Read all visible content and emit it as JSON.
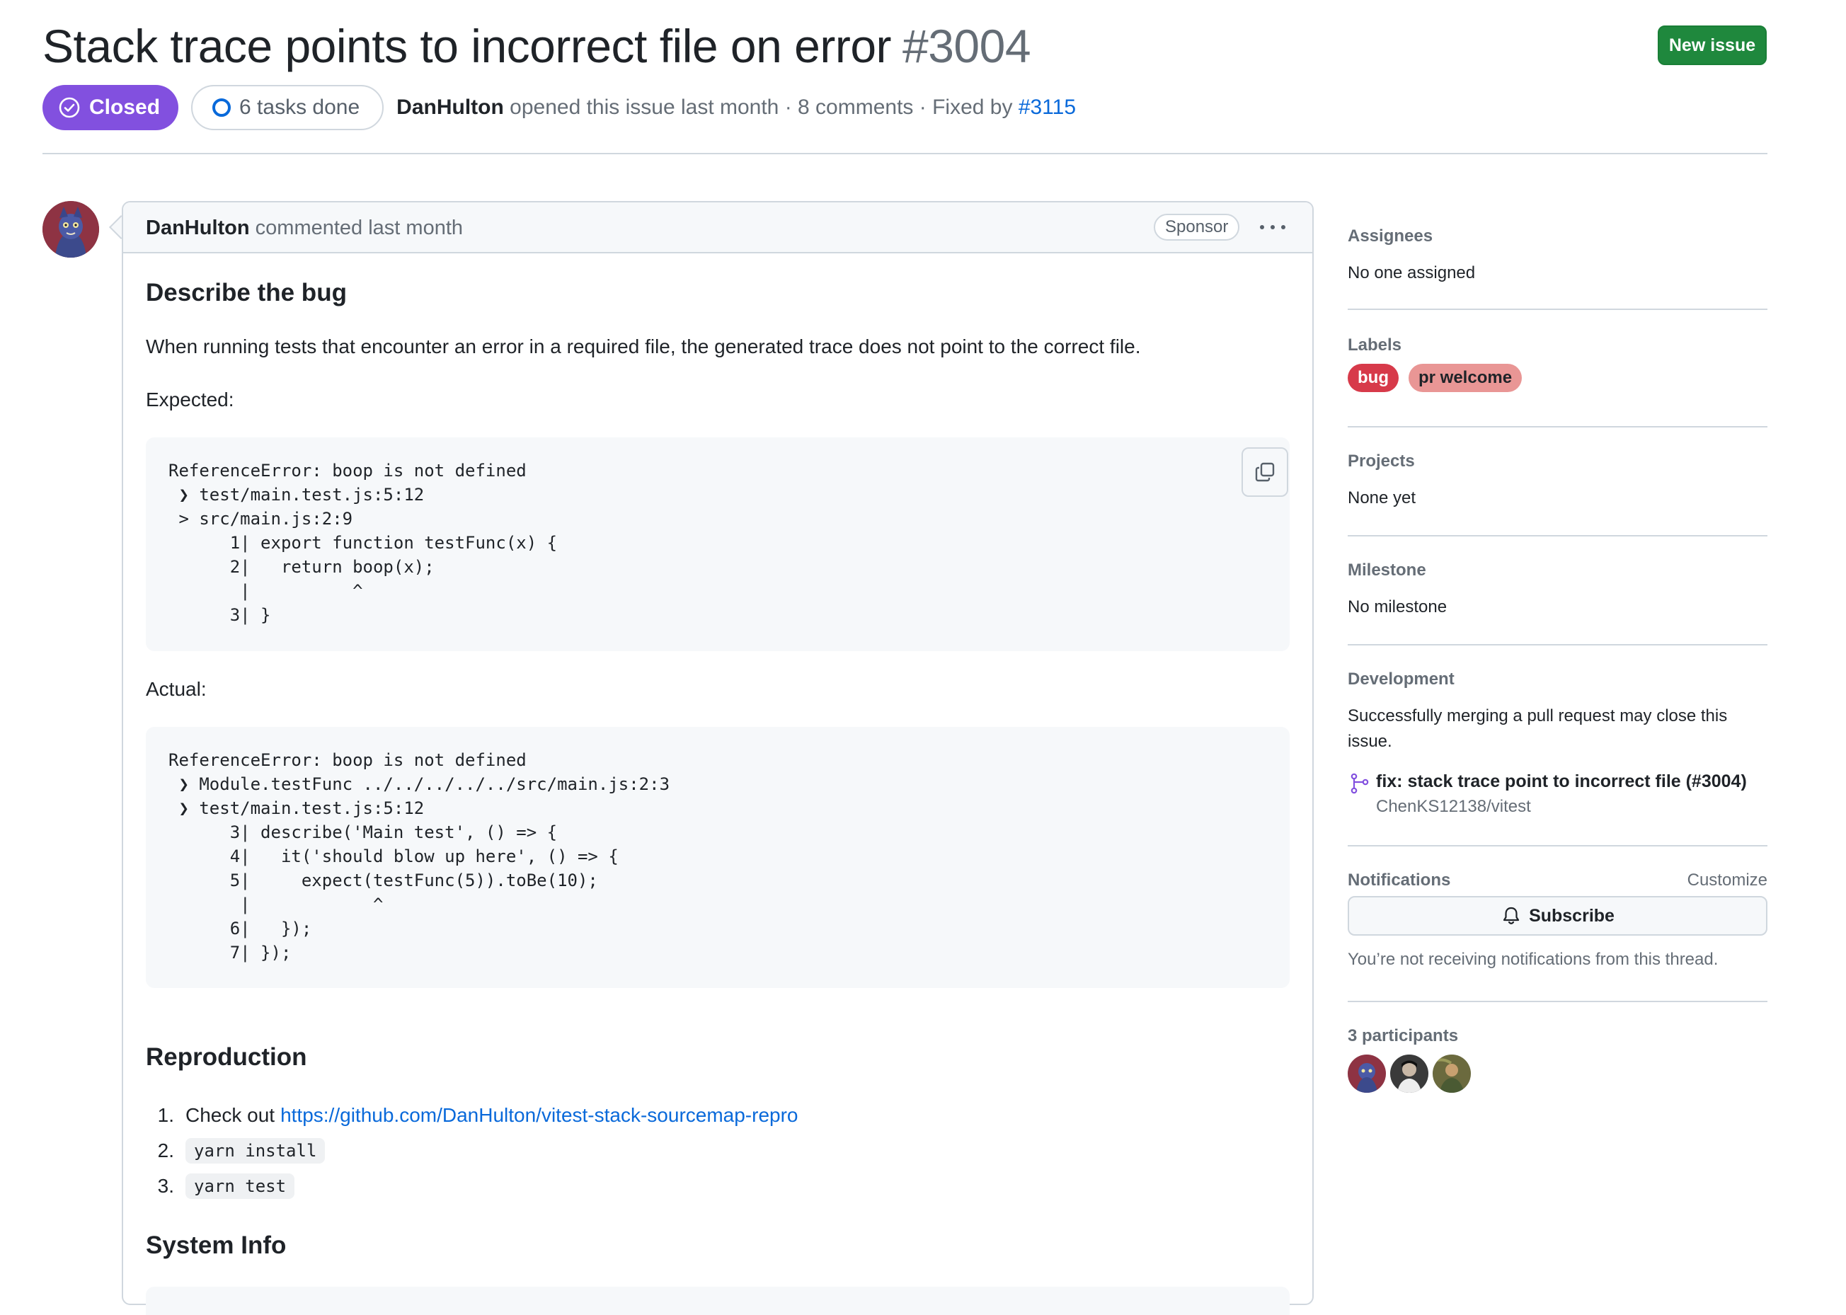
{
  "header": {
    "title": "Stack trace points to incorrect file on error",
    "number": "#3004",
    "new_issue_label": "New issue",
    "state": "Closed",
    "tasks": "6 tasks done",
    "author": "DanHulton",
    "opened_text": "opened this issue last month · 8 comments · Fixed by",
    "fixed_by": "#3115"
  },
  "comment": {
    "author": "DanHulton",
    "meta": "commented last month",
    "sponsor_label": "Sponsor",
    "sections": {
      "bug_heading": "Describe the bug",
      "bug_text": "When running tests that encounter an error in a required file, the generated trace does not point to the correct file.",
      "expected_label": "Expected:",
      "expected_code": "ReferenceError: boop is not defined\n ❯ test/main.test.js:5:12\n > src/main.js:2:9\n      1| export function testFunc(x) {\n      2|   return boop(x);\n       |          ^\n      3| }",
      "actual_label": "Actual:",
      "actual_code": "ReferenceError: boop is not defined\n ❯ Module.testFunc ../../../../../src/main.js:2:3\n ❯ test/main.test.js:5:12\n      3| describe('Main test', () => {\n      4|   it('should blow up here', () => {\n      5|     expect(testFunc(5)).toBe(10);\n       |            ^\n      6|   });\n      7| });",
      "repro_heading": "Reproduction",
      "repro_steps": [
        {
          "num": "1.",
          "text": "Check out",
          "link": "https://github.com/DanHulton/vitest-stack-sourcemap-repro"
        },
        {
          "num": "2.",
          "code": "yarn install"
        },
        {
          "num": "3.",
          "code": "yarn test"
        }
      ],
      "sysinfo_heading": "System Info"
    }
  },
  "sidebar": {
    "assignees": {
      "heading": "Assignees",
      "value": "No one assigned"
    },
    "labels": {
      "heading": "Labels",
      "items": [
        {
          "name": "bug",
          "bg": "#d73a4a",
          "fg": "#ffffff"
        },
        {
          "name": "pr welcome",
          "bg": "#e99695",
          "fg": "#1f2328"
        }
      ]
    },
    "projects": {
      "heading": "Projects",
      "value": "None yet"
    },
    "milestone": {
      "heading": "Milestone",
      "value": "No milestone"
    },
    "development": {
      "heading": "Development",
      "text_line1": "Successfully merging a pull request may close this",
      "text_line2": "issue.",
      "pr_title": "fix: stack trace point to incorrect file (#3004)",
      "pr_repo": "ChenKS12138/vitest"
    },
    "notifications": {
      "heading": "Notifications",
      "customize": "Customize",
      "subscribe": "Subscribe",
      "note": "You’re not receiving notifications from this thread."
    },
    "participants": {
      "heading": "3 participants",
      "count": 3
    }
  },
  "colors": {
    "closed_purple": "#8250df",
    "primary_green": "#1f883d",
    "link_blue": "#0969da",
    "muted_text": "#656d76",
    "border": "#d0d7de"
  }
}
